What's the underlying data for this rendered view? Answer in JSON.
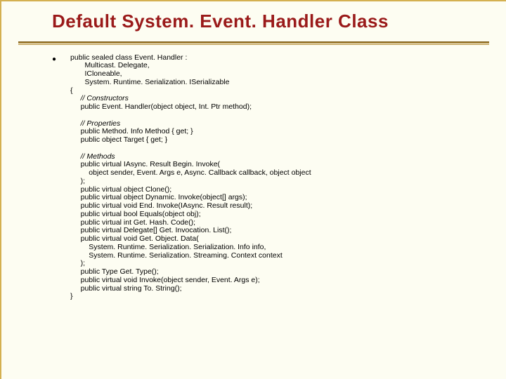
{
  "slide": {
    "title": "Default System. Event. Handler Class",
    "bullet_glyph": "●",
    "code": {
      "l01": "public sealed class Event. Handler :",
      "l02": "       Multicast. Delegate,",
      "l03": "       ICloneable,",
      "l04": "       System. Runtime. Serialization. ISerializable",
      "l05": "{",
      "c01": "     // Constructors",
      "l06": "     public Event. Handler(object object, Int. Ptr method);",
      "blank1": "",
      "c02": "     // Properties",
      "l07": "     public Method. Info Method { get; }",
      "l08": "     public object Target { get; }",
      "blank2": "",
      "c03": "     // Methods",
      "l09": "     public virtual IAsync. Result Begin. Invoke(",
      "l10": "         object sender, Event. Args e, Async. Callback callback, object object",
      "l11": "     );",
      "l12": "     public virtual object Clone();",
      "l13": "     public virtual object Dynamic. Invoke(object[] args);",
      "l14": "     public virtual void End. Invoke(IAsync. Result result);",
      "l15": "     public virtual bool Equals(object obj);",
      "l16": "     public virtual int Get. Hash. Code();",
      "l17": "     public virtual Delegate[] Get. Invocation. List();",
      "l18": "     public virtual void Get. Object. Data(",
      "l19": "         System. Runtime. Serialization. Serialization. Info info,",
      "l20": "         System. Runtime. Serialization. Streaming. Context context",
      "l21": "     );",
      "l22": "     public Type Get. Type();",
      "l23": "     public virtual void Invoke(object sender, Event. Args e);",
      "l24": "     public virtual string To. String();",
      "l25": "}"
    }
  }
}
